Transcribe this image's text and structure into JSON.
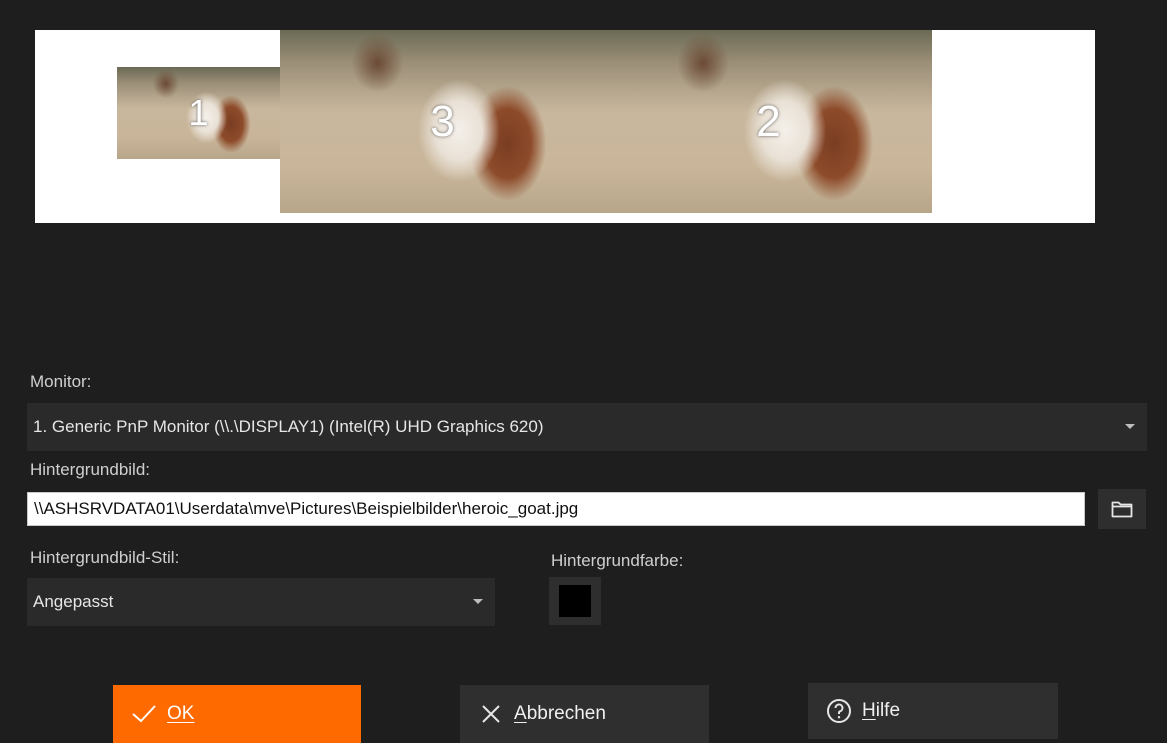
{
  "preview": {
    "monitors": [
      {
        "number": "1"
      },
      {
        "number": "3"
      },
      {
        "number": "2"
      }
    ]
  },
  "monitor": {
    "label": "Monitor:",
    "selected": "1. Generic PnP Monitor (\\\\.\\DISPLAY1) (Intel(R) UHD Graphics 620)"
  },
  "wallpaper": {
    "label": "Hintergrundbild:",
    "path": "\\\\ASHSRVDATA01\\Userdata\\mve\\Pictures\\Beispielbilder\\heroic_goat.jpg",
    "browse_icon": "folder-icon"
  },
  "style": {
    "label": "Hintergrundbild-Stil:",
    "selected": "Angepasst"
  },
  "bgcolor": {
    "label": "Hintergrundfarbe:",
    "value": "#000000"
  },
  "buttons": {
    "ok": {
      "underlined": "O",
      "rest": "K"
    },
    "cancel": {
      "underlined": "A",
      "rest": "bbrechen"
    },
    "help": {
      "underlined": "H",
      "rest": "ilfe"
    }
  },
  "colors": {
    "accent": "#ff6a00",
    "background": "#1e1e1e"
  }
}
